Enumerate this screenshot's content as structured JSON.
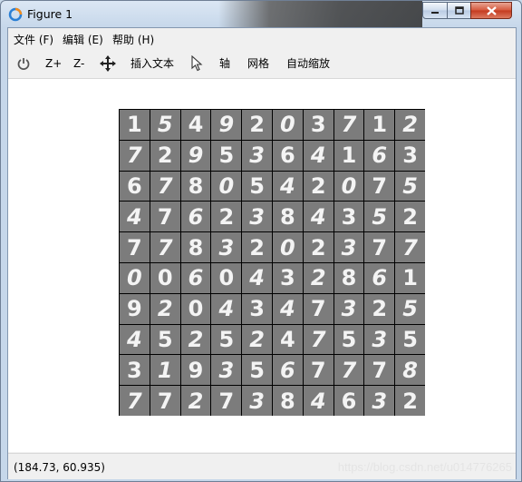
{
  "window": {
    "title": "Figure 1"
  },
  "menu": {
    "items": [
      "文件 (F)",
      "编辑 (E)",
      "帮助 (H)"
    ]
  },
  "toolbar": {
    "zoom_in": "Z+",
    "zoom_out": "Z-",
    "insert_text": "插入文本",
    "axis": "轴",
    "grid": "网格",
    "autoscale": "自动缩放"
  },
  "figure": {
    "digits": [
      [
        "1",
        "5",
        "4",
        "9",
        "2",
        "0",
        "3",
        "7",
        "1",
        "2"
      ],
      [
        "7",
        "2",
        "9",
        "5",
        "3",
        "6",
        "4",
        "1",
        "6",
        "3"
      ],
      [
        "6",
        "7",
        "8",
        "0",
        "5",
        "4",
        "2",
        "0",
        "7",
        "5"
      ],
      [
        "4",
        "7",
        "6",
        "2",
        "3",
        "8",
        "4",
        "3",
        "5",
        "2"
      ],
      [
        "7",
        "7",
        "8",
        "3",
        "2",
        "0",
        "2",
        "3",
        "7",
        "7"
      ],
      [
        "0",
        "0",
        "6",
        "0",
        "4",
        "3",
        "2",
        "8",
        "6",
        "1"
      ],
      [
        "9",
        "2",
        "0",
        "4",
        "3",
        "4",
        "7",
        "3",
        "2",
        "5"
      ],
      [
        "4",
        "5",
        "2",
        "5",
        "2",
        "4",
        "7",
        "5",
        "3",
        "5"
      ],
      [
        "3",
        "1",
        "9",
        "3",
        "5",
        "6",
        "7",
        "7",
        "7",
        "8"
      ],
      [
        "7",
        "7",
        "2",
        "7",
        "3",
        "8",
        "4",
        "6",
        "3",
        "2"
      ]
    ]
  },
  "status": {
    "coordinates": "(184.73, 60.935)",
    "watermark": "https://blog.csdn.net/u014776265"
  },
  "colors": {
    "cell_bg": "#7c7c7c",
    "digit": "#f4f4f4",
    "grid_line": "#000000"
  }
}
